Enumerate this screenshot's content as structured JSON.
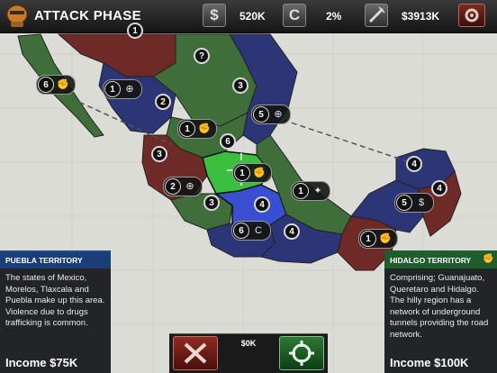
{
  "header": {
    "phase": "ATTACK PHASE",
    "resources": [
      {
        "icon": "dollar-icon",
        "value": "520K"
      },
      {
        "icon": "cartel-c-icon",
        "value": "2%"
      },
      {
        "icon": "syringe-icon",
        "value": "$3913K"
      }
    ]
  },
  "markers": [
    {
      "name": "marker-baja",
      "count": "6",
      "unit": "fist"
    },
    {
      "name": "marker-sonora-target",
      "count": "1",
      "unit": "target"
    },
    {
      "name": "marker-chihuahua-unknown",
      "count": "",
      "unit": "unknown"
    },
    {
      "name": "marker-sinaloa",
      "count": "2",
      "unit": ""
    },
    {
      "name": "marker-coahuila",
      "count": "3",
      "unit": ""
    },
    {
      "name": "marker-nuevo-leon-target",
      "count": "5",
      "unit": "target"
    },
    {
      "name": "marker-durango",
      "count": "1",
      "unit": "fist"
    },
    {
      "name": "marker-zacatecas",
      "count": "6",
      "unit": ""
    },
    {
      "name": "marker-nayarit",
      "count": "3",
      "unit": ""
    },
    {
      "name": "marker-jalisco-target",
      "count": "2",
      "unit": "target"
    },
    {
      "name": "marker-hidalgo-selected",
      "count": "1",
      "unit": "fist"
    },
    {
      "name": "marker-michoacan",
      "count": "3",
      "unit": ""
    },
    {
      "name": "marker-puebla",
      "count": "4",
      "unit": ""
    },
    {
      "name": "marker-veracruz-squad",
      "count": "1",
      "unit": "squad"
    },
    {
      "name": "marker-guerrero-c",
      "count": "6",
      "unit": "c"
    },
    {
      "name": "marker-oaxaca",
      "count": "4",
      "unit": ""
    },
    {
      "name": "marker-chiapas",
      "count": "1",
      "unit": "fist"
    },
    {
      "name": "marker-yucatan",
      "count": "4",
      "unit": ""
    },
    {
      "name": "marker-campeche-dollar",
      "count": "5",
      "unit": "dollar"
    },
    {
      "name": "marker-quintana-roo",
      "count": "4",
      "unit": ""
    },
    {
      "name": "marker-top",
      "count": "1",
      "unit": ""
    }
  ],
  "left_panel": {
    "title": "PUEBLA TERRITORY",
    "description": "The states of Mexico, Morelos, Tlaxcala and Puebla make up this area. Violence due to drugs trafficking is common.",
    "income": "Income $75K"
  },
  "right_panel": {
    "title": "HIDALGO TERRITORY",
    "description": "Comprising; Guanajuato, Queretaro and Hidalgo. The hilly region has a network of underground tunnels providing the road network.",
    "income": "Income $100K"
  },
  "controls": {
    "cost": "$0K"
  },
  "colors": {
    "cartel_green": "#3f6e3a",
    "cartel_red": "#6e2a27",
    "cartel_blue": "#2c3676",
    "selected_green": "#3bbf3e",
    "selected_blue": "#3a4fcf",
    "sea": "#dcdcd6"
  }
}
